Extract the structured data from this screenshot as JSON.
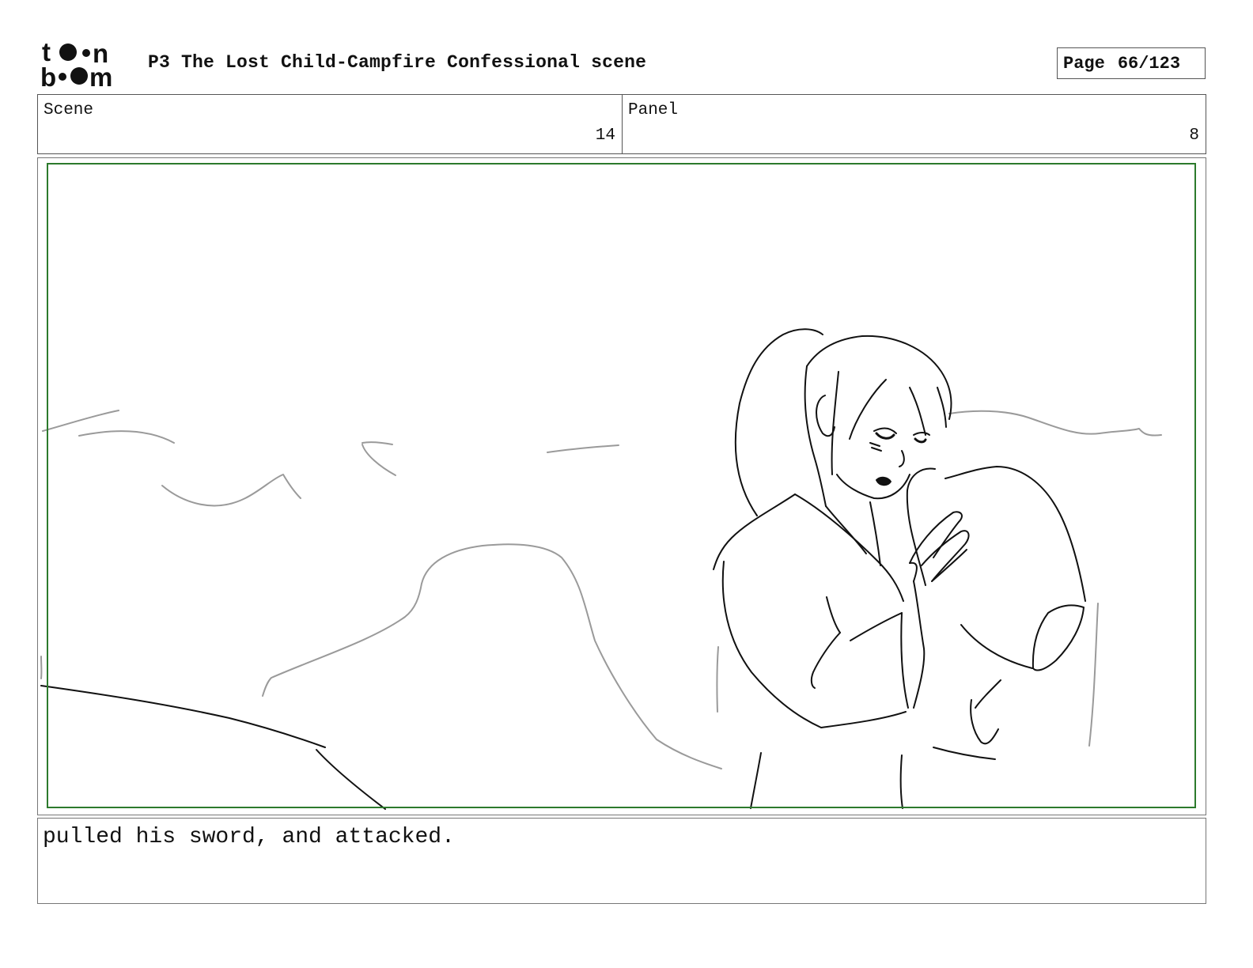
{
  "header": {
    "logo_text": "toon boom",
    "project_title": "P3 The Lost Child-Campfire Confessional scene",
    "page_label": "Page",
    "page_number": "66/123"
  },
  "info": {
    "scene_label": "Scene",
    "scene_value": "14",
    "panel_label": "Panel",
    "panel_value": "8"
  },
  "caption": {
    "text": "pulled his sword, and attacked."
  },
  "colors": {
    "safe_frame": "#2c7a2c",
    "ink": "#111111",
    "background_lines": "#9a9a9a"
  }
}
